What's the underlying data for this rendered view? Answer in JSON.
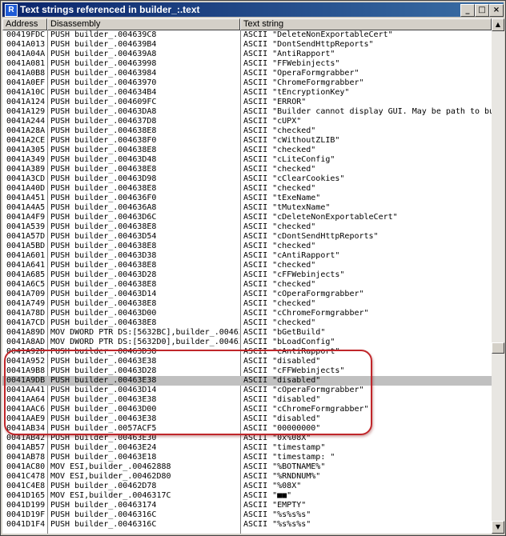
{
  "window": {
    "title": "Text strings referenced in builder_:.text",
    "icon_letter": "R",
    "minimize_glyph": "_",
    "maximize_glyph": "□",
    "close_glyph": "×"
  },
  "columns": [
    "Address",
    "Disassembly",
    "Text string"
  ],
  "scrollbar": {
    "up_glyph": "▲",
    "down_glyph": "▼"
  },
  "selected_row_index": 36,
  "rows": [
    [
      "00419FDC",
      "PUSH builder_.004639C8",
      "ASCII \"DeleteNonExportableCert\""
    ],
    [
      "0041A013",
      "PUSH builder_.004639B4",
      "ASCII \"DontSendHttpReports\""
    ],
    [
      "0041A04A",
      "PUSH builder_.004639A8",
      "ASCII \"AntiRapport\""
    ],
    [
      "0041A081",
      "PUSH builder_.00463998",
      "ASCII \"FFWebinjects\""
    ],
    [
      "0041A0B8",
      "PUSH builder_.00463984",
      "ASCII \"OperaFormgrabber\""
    ],
    [
      "0041A0EF",
      "PUSH builder_.00463970",
      "ASCII \"ChromeFormgrabber\""
    ],
    [
      "0041A10C",
      "PUSH builder_.004634B4",
      "ASCII \"tEncryptionKey\""
    ],
    [
      "0041A124",
      "PUSH builder_.004609FC",
      "ASCII \"ERROR\""
    ],
    [
      "0041A129",
      "PUSH builder_.00463DA8",
      "ASCII \"Builder cannot display GUI. May be path to bu"
    ],
    [
      "0041A244",
      "PUSH builder_.004637D8",
      "ASCII \"cUPX\""
    ],
    [
      "0041A28A",
      "PUSH builder_.004638E8",
      "ASCII \"checked\""
    ],
    [
      "0041A2CE",
      "PUSH builder_.004638F0",
      "ASCII \"cWithoutZLIB\""
    ],
    [
      "0041A305",
      "PUSH builder_.004638E8",
      "ASCII \"checked\""
    ],
    [
      "0041A349",
      "PUSH builder_.00463D48",
      "ASCII \"cLiteConfig\""
    ],
    [
      "0041A389",
      "PUSH builder_.004638E8",
      "ASCII \"checked\""
    ],
    [
      "0041A3CD",
      "PUSH builder_.00463D98",
      "ASCII \"cClearCookies\""
    ],
    [
      "0041A40D",
      "PUSH builder_.004638E8",
      "ASCII \"checked\""
    ],
    [
      "0041A451",
      "PUSH builder_.004636F0",
      "ASCII \"tExeName\""
    ],
    [
      "0041A4A5",
      "PUSH builder_.004636A8",
      "ASCII \"tMutexName\""
    ],
    [
      "0041A4F9",
      "PUSH builder_.00463D6C",
      "ASCII \"cDeleteNonExportableCert\""
    ],
    [
      "0041A539",
      "PUSH builder_.004638E8",
      "ASCII \"checked\""
    ],
    [
      "0041A57D",
      "PUSH builder_.00463D54",
      "ASCII \"cDontSendHttpReports\""
    ],
    [
      "0041A5BD",
      "PUSH builder_.004638E8",
      "ASCII \"checked\""
    ],
    [
      "0041A601",
      "PUSH builder_.00463D38",
      "ASCII \"cAntiRapport\""
    ],
    [
      "0041A641",
      "PUSH builder_.004638E8",
      "ASCII \"checked\""
    ],
    [
      "0041A685",
      "PUSH builder_.00463D28",
      "ASCII \"cFFWebinjects\""
    ],
    [
      "0041A6C5",
      "PUSH builder_.004638E8",
      "ASCII \"checked\""
    ],
    [
      "0041A709",
      "PUSH builder_.00463D14",
      "ASCII \"cOperaFormgrabber\""
    ],
    [
      "0041A749",
      "PUSH builder_.004638E8",
      "ASCII \"checked\""
    ],
    [
      "0041A78D",
      "PUSH builder_.00463D00",
      "ASCII \"cChromeFormgrabber\""
    ],
    [
      "0041A7CD",
      "PUSH builder_.004638E8",
      "ASCII \"checked\""
    ],
    [
      "0041A89D",
      "MOV DWORD PTR DS:[5632BC],builder_.00463",
      "ASCII \"bGetBuild\""
    ],
    [
      "0041A8AD",
      "MOV DWORD PTR DS:[5632D0],builder_.00463",
      "ASCII \"bLoadConfig\""
    ],
    [
      "0041A92D",
      "PUSH builder_.00463D38",
      "ASCII \"cAntiRapport\""
    ],
    [
      "0041A952",
      "PUSH builder_.00463E38",
      "ASCII \"disabled\""
    ],
    [
      "0041A9B8",
      "PUSH builder_.00463D28",
      "ASCII \"cFFWebinjects\""
    ],
    [
      "0041A9DB",
      "PUSH builder_.00463E38",
      "ASCII \"disabled\""
    ],
    [
      "0041AA41",
      "PUSH builder_.00463D14",
      "ASCII \"cOperaFormgrabber\""
    ],
    [
      "0041AA64",
      "PUSH builder_.00463E38",
      "ASCII \"disabled\""
    ],
    [
      "0041AAC6",
      "PUSH builder_.00463D00",
      "ASCII \"cChromeFormgrabber\""
    ],
    [
      "0041AAE9",
      "PUSH builder_.00463E38",
      "ASCII \"disabled\""
    ],
    [
      "0041AB34",
      "PUSH builder_.0057ACF5",
      "ASCII \"00000000\""
    ],
    [
      "0041AB42",
      "PUSH builder_.00463E30",
      "ASCII \"0x%08X\""
    ],
    [
      "0041AB57",
      "PUSH builder_.00463E24",
      "ASCII \"timestamp\""
    ],
    [
      "0041AB78",
      "PUSH builder_.00463E18",
      "ASCII \"timestamp: \""
    ],
    [
      "0041AC80",
      "MOV ESI,builder_.00462888",
      "ASCII \"%BOTNAME%\""
    ],
    [
      "0041C478",
      "MOV ESI,builder_.00462D80",
      "ASCII \"%RNDNUM%\""
    ],
    [
      "0041C4E8",
      "PUSH builder_.00462D78",
      "ASCII \"%08X\""
    ],
    [
      "0041D165",
      "MOV ESI,builder_.0046317C",
      "ASCII \"■■\""
    ],
    [
      "0041D199",
      "PUSH builder_.00463174",
      "ASCII \"EMPTY\""
    ],
    [
      "0041D19F",
      "PUSH builder_.0046316C",
      "ASCII \"%s%s%s\""
    ],
    [
      "0041D1F4",
      "PUSH builder_.0046316C",
      "ASCII \"%s%s%s\""
    ]
  ]
}
